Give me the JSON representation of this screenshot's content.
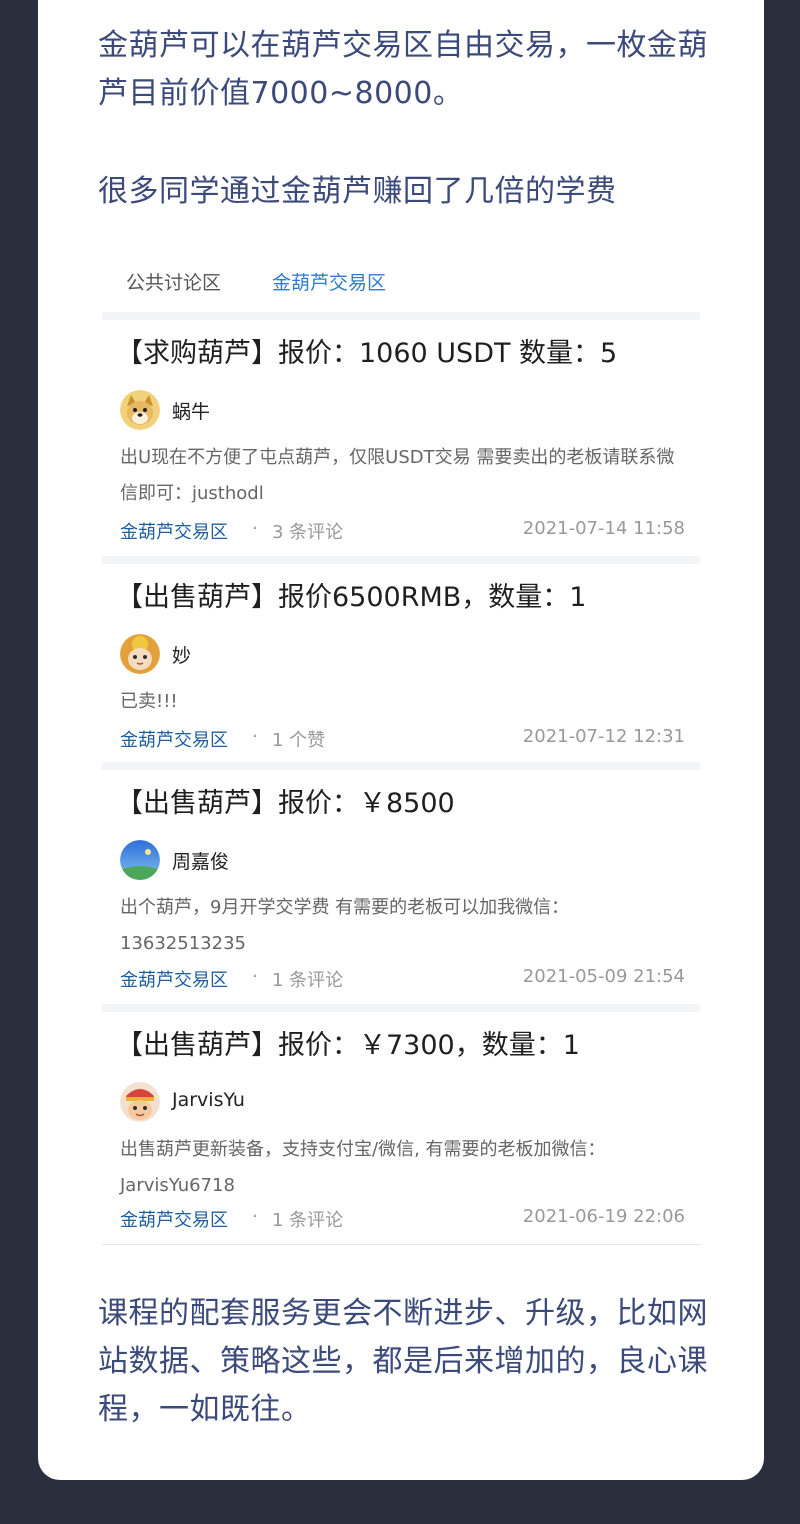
{
  "intro": {
    "paragraph_1": "金葫芦可以在葫芦交易区自由交易，一枚金葫芦目前价值7000~8000。",
    "paragraph_2": "很多同学通过金葫芦赚回了几倍的学费"
  },
  "tabs": [
    {
      "label": "公共讨论区",
      "active": false
    },
    {
      "label": "金葫芦交易区",
      "active": true
    }
  ],
  "posts": [
    {
      "title": "【求购葫芦】报价：1060 USDT 数量：5",
      "author": "蜗牛",
      "avatar_icon": "doge-avatar-icon",
      "excerpt": "出U现在不方便了屯点葫芦，仅限USDT交易 需要卖出的老板请联系微信即可：justhodl",
      "category": "金葫芦交易区",
      "separator": "·",
      "stat": "3 条评论",
      "date": "2021-07-14 11:58"
    },
    {
      "title": "【出售葫芦】报价6500RMB，数量：1",
      "author": "妙",
      "avatar_icon": "cat-avatar-icon",
      "excerpt": "已卖!!!",
      "category": "金葫芦交易区",
      "separator": "·",
      "stat": "1 个赞",
      "date": "2021-07-12 12:31"
    },
    {
      "title": "【出售葫芦】报价：￥8500",
      "author": "周嘉俊",
      "avatar_icon": "sky-avatar-icon",
      "excerpt": "出个葫芦，9月开学交学费 有需要的老板可以加我微信：13632513235",
      "category": "金葫芦交易区",
      "separator": "·",
      "stat": "1 条评论",
      "date": "2021-05-09 21:54"
    },
    {
      "title": "【出售葫芦】报价：￥7300，数量：1",
      "author": "JarvisYu",
      "avatar_icon": "cartoon-avatar-icon",
      "excerpt": "出售葫芦更新装备，支持支付宝/微信, 有需要的老板加微信：JarvisYu6718",
      "category": "金葫芦交易区",
      "separator": "·",
      "stat": "1 条评论",
      "date": "2021-06-19 22:06"
    }
  ],
  "outro": {
    "paragraph_3": "课程的配套服务更会不断进步、升级，比如网站数据、策略这些，都是后来增加的，良心课程，一如既往。"
  },
  "colors": {
    "background": "#2b2f3d",
    "card": "#ffffff",
    "heading_text": "#3b4a7a",
    "tab_active": "#2f7bd0",
    "category_link": "#1f5f9e"
  }
}
